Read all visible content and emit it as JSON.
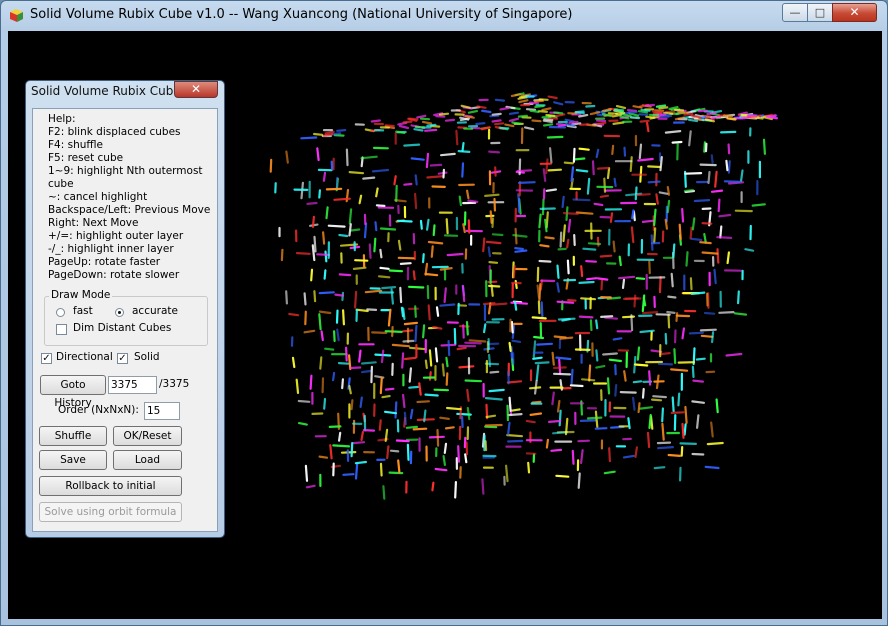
{
  "window": {
    "title": "Solid Volume Rubix Cube v1.0 -- Wang Xuancong (National University of Singapore)",
    "minimize_glyph": "—",
    "maximize_glyph": "□",
    "close_glyph": "✕"
  },
  "panel": {
    "title": "Solid Volume Rubix Cube",
    "close_glyph": "✕",
    "help_lines": [
      "Help:",
      "F2: blink displaced cubes",
      "F4: shuffle",
      "F5: reset cube",
      "1~9: highlight Nth outermost",
      "cube",
      "~: cancel highlight",
      "Backspace/Left: Previous Move",
      "Right: Next Move",
      "+/=: highlight outer layer",
      "-/_: highlight inner layer",
      "PageUp: rotate faster",
      "PageDown: rotate slower"
    ],
    "draw_mode": {
      "label": "Draw Mode",
      "fast_label": "fast",
      "fast_selected": false,
      "accurate_label": "accurate",
      "accurate_selected": true,
      "dim_label": "Dim Distant Cubes",
      "dim_checked": false
    },
    "directional_label": "Directional",
    "directional_checked": true,
    "solid_label": "Solid",
    "solid_checked": true,
    "goto_history_label": "Goto History",
    "history_value": "3375",
    "history_total": "/3375",
    "order_label": "Order (NxNxN):",
    "order_value": "15",
    "shuffle_label": "Shuffle",
    "ok_reset_label": "OK/Reset",
    "save_label": "Save",
    "load_label": "Load",
    "rollback_label": "Rollback to initial",
    "solve_label": "Solve using orbit formula"
  },
  "cube_colors": [
    "#ff3030",
    "#30ff40",
    "#3060ff",
    "#ffff30",
    "#ff30ff",
    "#30ffff",
    "#ff9020",
    "#ffffff"
  ]
}
